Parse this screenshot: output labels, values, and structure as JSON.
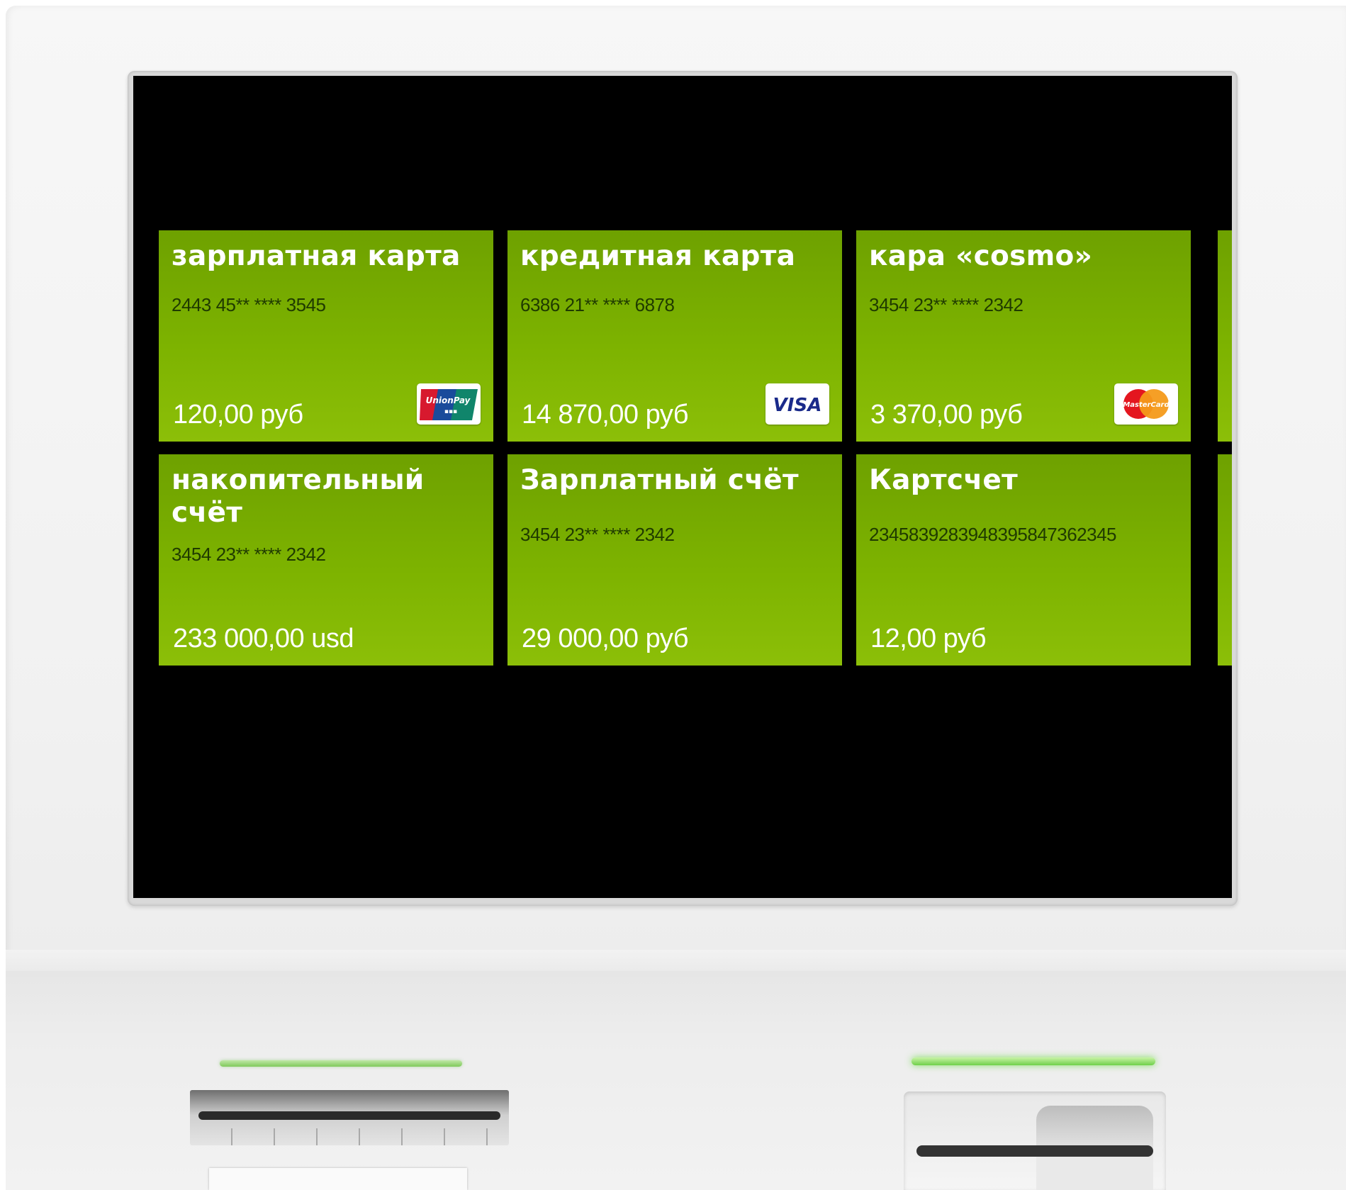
{
  "screen": {
    "accounts": [
      {
        "title": "зарплатная карта",
        "number": "2443 45** **** 3545",
        "balance": "120,00 руб",
        "brand": "unionpay-icon"
      },
      {
        "title": "кредитная карта",
        "number": "6386 21** **** 6878",
        "balance": "14 870,00 руб",
        "brand": "visa-icon"
      },
      {
        "title": "кара «cosmo»",
        "number": "3454 23** **** 2342",
        "balance": "3 370,00  руб",
        "brand": "mastercard-icon"
      },
      {
        "title": "накопительный счёт",
        "number": "3454 23** **** 2342",
        "balance": "233 000,00 usd"
      },
      {
        "title": "Зарплатный счёт",
        "number": "3454 23** **** 2342",
        "balance": "29 000,00 руб"
      },
      {
        "title": "Картсчет",
        "number": "2345839283948395847362345",
        "balance": "12,00 руб"
      }
    ]
  },
  "brands": {
    "unionpay_text": "UnionPay",
    "visa_text": "VISA",
    "mastercard_text": "MasterCard"
  },
  "colors": {
    "tile_green": "#7db300",
    "screen_bg": "#000000",
    "led_green": "#7fc95c"
  }
}
